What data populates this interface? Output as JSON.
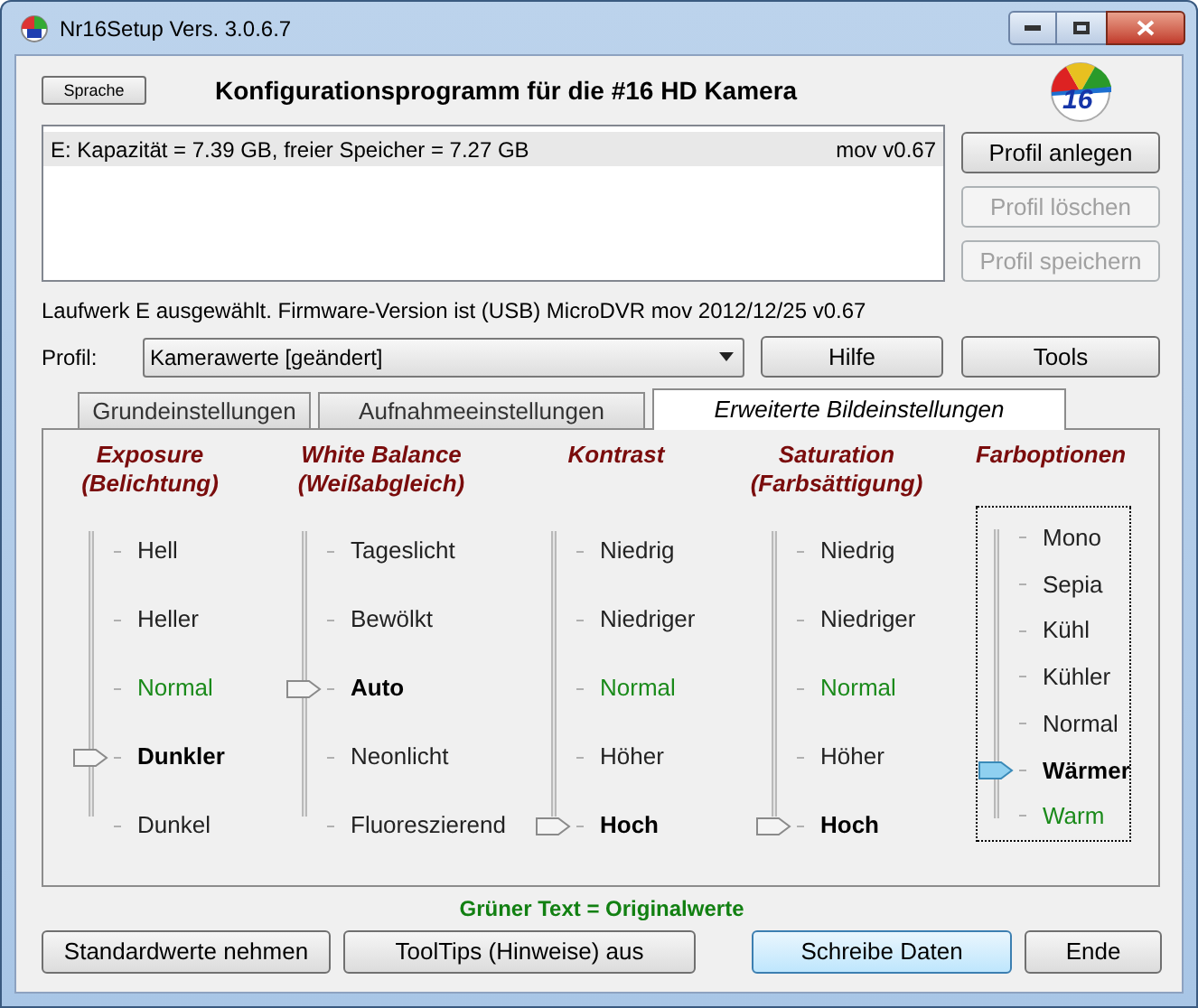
{
  "window": {
    "title": "Nr16Setup  Vers. 3.0.6.7"
  },
  "language_button": "Sprache",
  "heading": "Konfigurationsprogramm für die #16 HD Kamera",
  "logo_text": "16",
  "drives": [
    {
      "label": "E:  Kapazität = 7.39 GB, freier Speicher = 7.27 GB",
      "version": "mov v0.67",
      "selected": true
    }
  ],
  "profile_buttons": [
    {
      "label": "Profil anlegen",
      "disabled": false
    },
    {
      "label": "Profil löschen",
      "disabled": true
    },
    {
      "label": "Profil speichern",
      "disabled": true
    }
  ],
  "status": "Laufwerk E ausgewählt. Firmware-Version ist (USB) MicroDVR mov 2012/12/25 v0.67",
  "profile": {
    "label": "Profil:",
    "value": "Kamerawerte [geändert]"
  },
  "help_button": "Hilfe",
  "tools_button": "Tools",
  "tabs": [
    {
      "label": "Grundeinstellungen",
      "selected": false
    },
    {
      "label": "Aufnahmeeinstellungen",
      "selected": false
    },
    {
      "label": "Erweiterte Bildeinstellungen",
      "selected": true
    }
  ],
  "sliders": [
    {
      "title": "Exposure",
      "subtitle": "(Belichtung)",
      "focused": false,
      "options": [
        {
          "label": "Hell",
          "selected": false,
          "original": false
        },
        {
          "label": "Heller",
          "selected": false,
          "original": false
        },
        {
          "label": "Normal",
          "selected": false,
          "original": true
        },
        {
          "label": "Dunkler",
          "selected": true,
          "original": false
        },
        {
          "label": "Dunkel",
          "selected": false,
          "original": false
        }
      ]
    },
    {
      "title": "White Balance",
      "subtitle": "(Weißabgleich)",
      "focused": false,
      "options": [
        {
          "label": "Tageslicht",
          "selected": false,
          "original": false
        },
        {
          "label": "Bewölkt",
          "selected": false,
          "original": false
        },
        {
          "label": "Auto",
          "selected": true,
          "original": false
        },
        {
          "label": "Neonlicht",
          "selected": false,
          "original": false
        },
        {
          "label": "Fluoreszierend",
          "selected": false,
          "original": false
        }
      ]
    },
    {
      "title": "Kontrast",
      "focused": false,
      "options": [
        {
          "label": "Niedrig",
          "selected": false,
          "original": false
        },
        {
          "label": "Niedriger",
          "selected": false,
          "original": false
        },
        {
          "label": "Normal",
          "selected": false,
          "original": true
        },
        {
          "label": "Höher",
          "selected": false,
          "original": false
        },
        {
          "label": "Hoch",
          "selected": true,
          "original": false
        }
      ]
    },
    {
      "title": "Saturation",
      "subtitle": "(Farbsättigung)",
      "focused": false,
      "options": [
        {
          "label": "Niedrig",
          "selected": false,
          "original": false
        },
        {
          "label": "Niedriger",
          "selected": false,
          "original": false
        },
        {
          "label": "Normal",
          "selected": false,
          "original": true
        },
        {
          "label": "Höher",
          "selected": false,
          "original": false
        },
        {
          "label": "Hoch",
          "selected": true,
          "original": false
        }
      ]
    },
    {
      "title": "Farboptionen",
      "focused": true,
      "options": [
        {
          "label": "Mono",
          "selected": false,
          "original": false
        },
        {
          "label": "Sepia",
          "selected": false,
          "original": false
        },
        {
          "label": "Kühl",
          "selected": false,
          "original": false
        },
        {
          "label": "Kühler",
          "selected": false,
          "original": false
        },
        {
          "label": "Normal",
          "selected": false,
          "original": false
        },
        {
          "label": "Wärmer",
          "selected": true,
          "original": false
        },
        {
          "label": "Warm",
          "selected": false,
          "original": true
        }
      ]
    }
  ],
  "legend": "Grüner Text = Originalwerte",
  "bottom_buttons": [
    {
      "label": "Standardwerte nehmen",
      "default": false
    },
    {
      "label": "ToolTips (Hinweise) aus",
      "default": false
    },
    {
      "label": "Schreibe Daten",
      "default": true
    },
    {
      "label": "Ende",
      "default": false
    }
  ]
}
